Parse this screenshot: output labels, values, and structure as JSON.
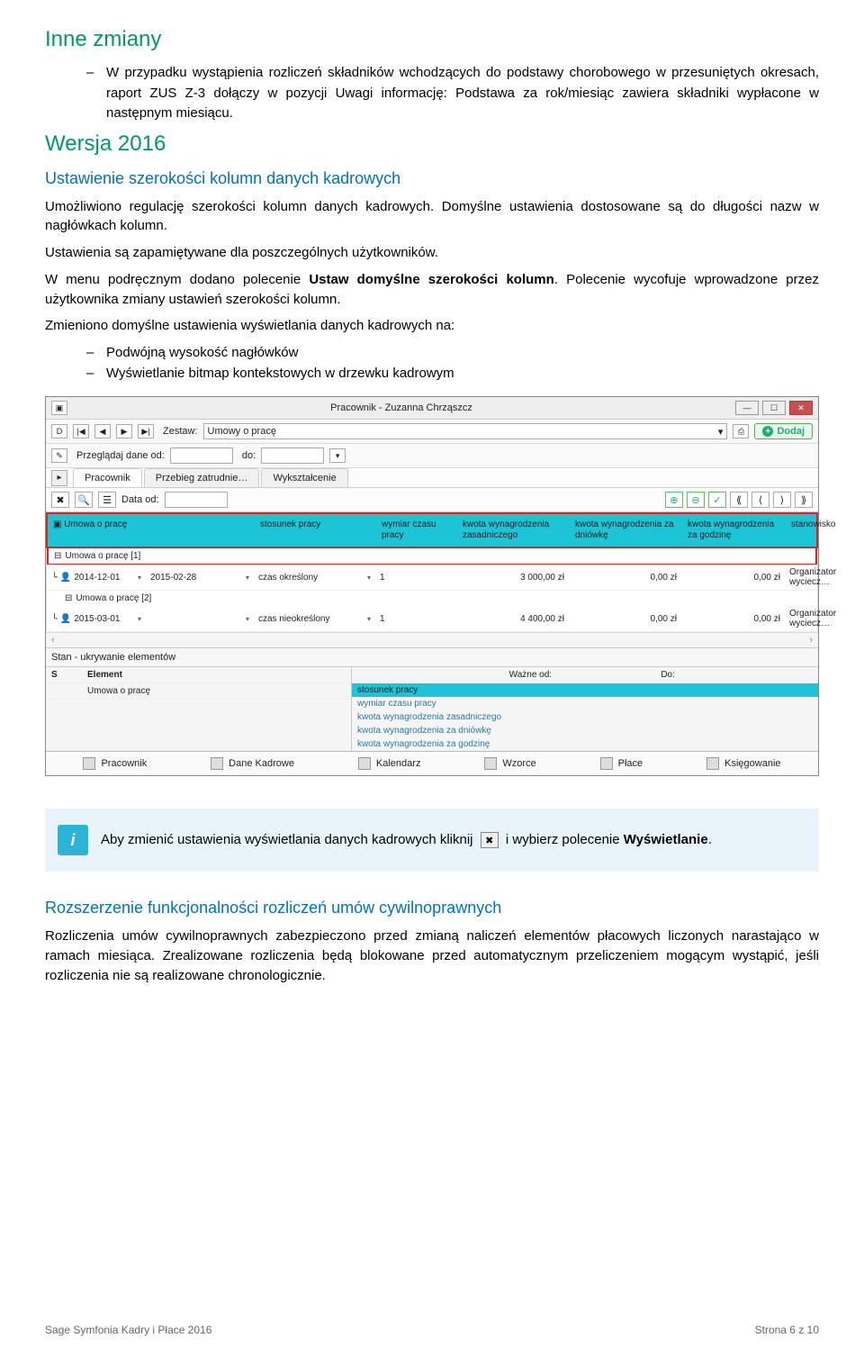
{
  "h1": "Inne zmiany",
  "bullet1": [
    "W przypadku wystąpienia rozliczeń składników wchodzących do podstawy chorobowego w przesuniętych okresach, raport ZUS Z-3 dołączy w pozycji Uwagi informację: Podstawa za rok/miesiąc zawiera składniki wypłacone w następnym miesiącu."
  ],
  "h2": "Wersja 2016",
  "blue1": "Ustawienie szerokości kolumn danych kadrowych",
  "p1": "Umożliwiono regulację szerokości kolumn danych kadrowych. Domyślne ustawienia dostosowane są do długości nazw w nagłówkach kolumn.",
  "p2": "Ustawienia są zapamiętywane dla poszczególnych użytkowników.",
  "p3a": "W menu podręcznym dodano polecenie ",
  "p3b": "Ustaw domyślne szerokości kolumn",
  "p3c": ". Polecenie wycofuje wprowadzone przez użytkownika zmiany ustawień szerokości kolumn.",
  "p4": "Zmieniono domyślne ustawienia wyświetlania danych kadrowych na:",
  "p4list": [
    "Podwójną wysokość nagłówków",
    "Wyświetlanie bitmap kontekstowych w drzewku kadrowym"
  ],
  "app": {
    "title": "Pracownik - Zuzanna Chrząszcz",
    "navLetter": "D",
    "zestawLbl": "Zestaw:",
    "zestawVal": "Umowy o pracę",
    "dodaj": "Dodaj",
    "browseLbl": "Przeglądaj dane od:",
    "doLbl": "do:",
    "tabs": [
      "Pracownik",
      "Przebieg zatrudnie…",
      "Wykształcenie"
    ],
    "dataOdLbl": "Data od:",
    "gridHeaders": [
      "Umowa o pracę",
      "stosunek pracy",
      "wymiar czasu pracy",
      "kwota wynagrodzenia zasadniczego",
      "kwota wynagrodzenia za dniówkę",
      "kwota wynagrodzenia za godzinę",
      "stanowisko"
    ],
    "group1": "Umowa o pracę [1]",
    "row1": {
      "d1": "2014-12-01",
      "d2": "2015-02-28",
      "rel": "czas określony",
      "dim": "1",
      "c1": "3 000,00 zł",
      "c2": "0,00 zł",
      "c3": "0,00 zł",
      "pos": "Organizator wyciecz…"
    },
    "group2": "Umowa o pracę [2]",
    "row2": {
      "d1": "2015-03-01",
      "d2": "",
      "rel": "czas nieokreślony",
      "dim": "1",
      "c1": "4 400,00 zł",
      "c2": "0,00 zł",
      "c3": "0,00 zł",
      "pos": "Organizator wyciecz…"
    },
    "stateHdr": "Stan - ukrywanie elementów",
    "stateCols": {
      "s": "S",
      "el": "Element"
    },
    "stateRows": [
      "Umowa o pracę"
    ],
    "rightHdr": {
      "blank": "",
      "od": "Ważne od:",
      "do": "Do:"
    },
    "rightLines": [
      "stosunek pracy",
      "wymiar czasu pracy",
      "kwota wynagrodzenia zasadniczego",
      "kwota wynagrodzenia za dniówkę",
      "kwota wynagrodzenia za godzinę"
    ],
    "bottomNav": [
      "Pracownik",
      "Dane Kadrowe",
      "Kalendarz",
      "Wzorce",
      "Płace",
      "Księgowanie"
    ]
  },
  "info": {
    "a": "Aby zmienić ustawienia wyświetlania danych kadrowych kliknij",
    "b": " i wybierz polecenie ",
    "c": "Wyświetlanie",
    "d": "."
  },
  "blue2": "Rozszerzenie funkcjonalności rozliczeń umów cywilnoprawnych",
  "p5": "Rozliczenia umów cywilnoprawnych zabezpieczono przed zmianą naliczeń elementów płacowych liczonych narastająco w ramach miesiąca. Zrealizowane rozliczenia będą blokowane przed automatycznym przeliczeniem mogącym wystąpić, jeśli rozliczenia nie są realizowane chronologicznie.",
  "footer": {
    "left": "Sage Symfonia Kadry i Płace 2016",
    "right": "Strona 6 z 10"
  }
}
